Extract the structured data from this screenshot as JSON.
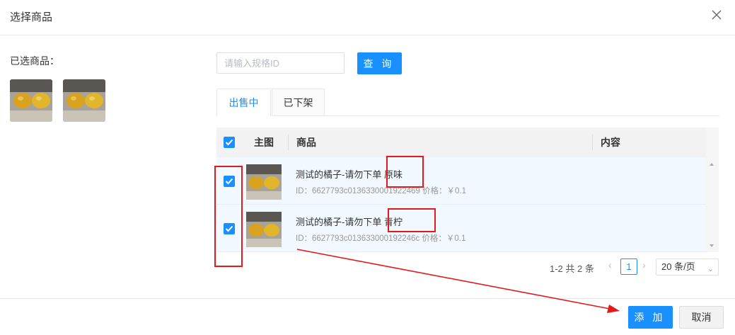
{
  "dialog": {
    "title": "选择商品"
  },
  "selected": {
    "label": "已选商品："
  },
  "search": {
    "placeholder": "请输入规格ID",
    "value": "",
    "button_label": "查 询"
  },
  "tabs": [
    {
      "label": "出售中",
      "active": true
    },
    {
      "label": "已下架",
      "active": false
    }
  ],
  "table": {
    "columns": [
      "主图",
      "商品",
      "内容"
    ],
    "header_checked": true,
    "rows": [
      {
        "checked": true,
        "name": "测试的橘子-请勿下单 原味",
        "meta": "ID：6627793c0136330001922469  价格：￥0.1"
      },
      {
        "checked": true,
        "name": "测试的橘子-请勿下单 青柠",
        "meta": "ID：6627793c013633000192246c  价格：￥0.1"
      }
    ]
  },
  "pagination": {
    "total_text": "1-2 共 2 条",
    "current_page": "1",
    "page_size": "20 条/页",
    "prev": "‹",
    "next": "›"
  },
  "footer": {
    "add_label": "添 加",
    "cancel_label": "取消"
  },
  "colors": {
    "primary": "#1890ff",
    "annotation_red": "#e3191c",
    "row_selected": "#f1f8ff"
  }
}
